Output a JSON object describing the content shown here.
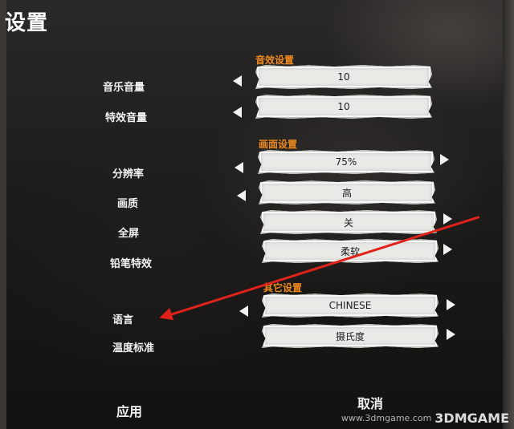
{
  "title": "设置",
  "sections": {
    "audio": "音效设置",
    "video": "画面设置",
    "other": "其它设置"
  },
  "rows": [
    {
      "label": "音乐音量",
      "value": "10"
    },
    {
      "label": "特效音量",
      "value": "10"
    },
    {
      "label": "分辨率",
      "value": "75%"
    },
    {
      "label": "画质",
      "value": "高"
    },
    {
      "label": "全屏",
      "value": "关"
    },
    {
      "label": "铅笔特效",
      "value": "柔软"
    },
    {
      "label": "语言",
      "value": "CHINESE"
    },
    {
      "label": "温度标准",
      "value": "摄氏度"
    }
  ],
  "footer": {
    "apply": "应用",
    "cancel": "取消"
  },
  "watermark": {
    "url": "www.3dmgame.com",
    "logo": "3DMGAME"
  },
  "colors": {
    "section_header": "#f08a1e",
    "annotation_arrow": "#e0221c",
    "value_box": "#e9e9e6"
  }
}
